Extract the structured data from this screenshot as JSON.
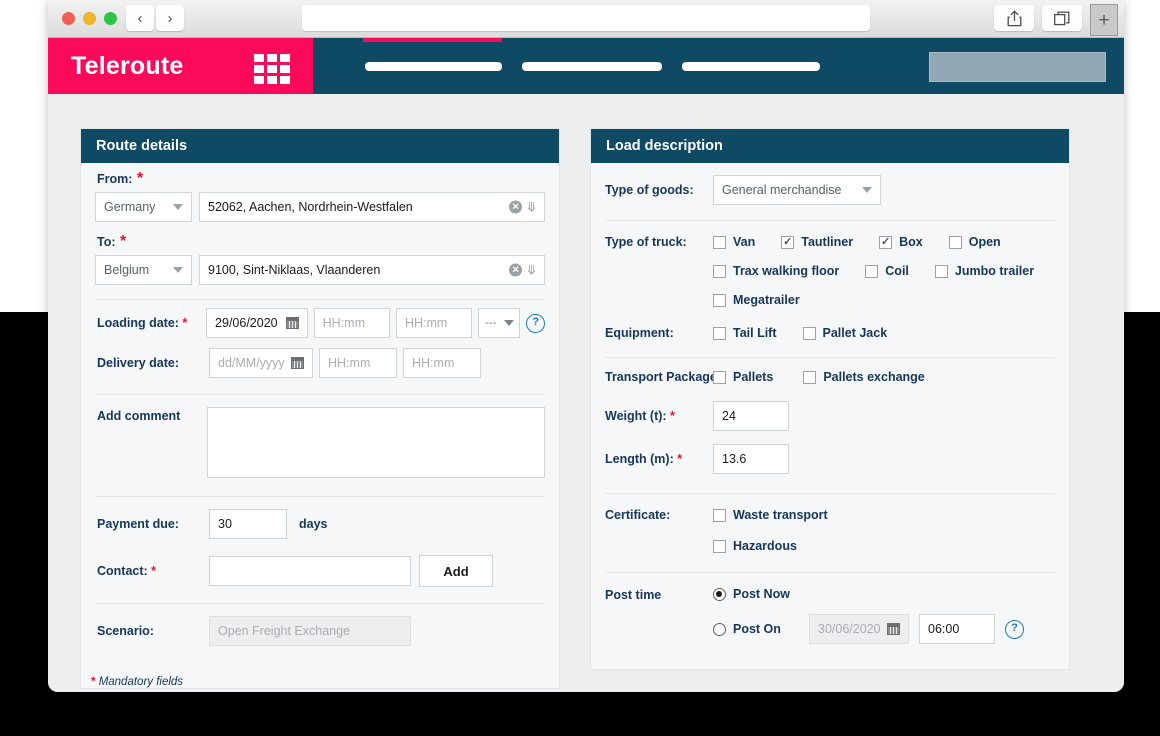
{
  "browser": {
    "back_icon": "‹",
    "forward_icon": "›",
    "url_value": "",
    "url_placeholder": "",
    "share_icon": "share-icon",
    "tabs_icon": "tabs-icon",
    "new_tab_label": "+"
  },
  "header": {
    "brand": "Teleroute",
    "apps_grid_icon": "grid-icon",
    "nav_items": [
      "",
      "",
      ""
    ],
    "account_box": ""
  },
  "route_panel": {
    "title": "Route details",
    "from_label": "From:",
    "from_country": "Germany",
    "from_location": "52062, Aachen, Nordrhein-Westfalen",
    "to_label": "To:",
    "to_country": "Belgium",
    "to_location": "9100, Sint-Niklaas, Vlaanderen",
    "loading_date_label": "Loading date:",
    "loading_date_value": "29/06/2020",
    "loading_time_from_placeholder": "HH:mm",
    "loading_time_to_placeholder": "HH:mm",
    "loading_select_value": "---",
    "delivery_date_label": "Delivery date:",
    "delivery_date_placeholder": "dd/MM/yyyy",
    "delivery_time_from_placeholder": "HH:mm",
    "delivery_time_to_placeholder": "HH:mm",
    "comment_label": "Add comment",
    "comment_value": "",
    "payment_due_label": "Payment due:",
    "payment_due_value": "30",
    "payment_due_unit": "days",
    "contact_label": "Contact:",
    "contact_value": "",
    "add_button": "Add",
    "scenario_label": "Scenario:",
    "scenario_value": "Open Freight Exchange",
    "mandatory_note": "Mandatory fields",
    "help_icon": "help-icon",
    "calendar_icon": "calendar-icon",
    "clear_icon": "clear-icon",
    "expand_icon": "double-chevron-down-icon"
  },
  "load_panel": {
    "title": "Load description",
    "goods_label": "Type of goods:",
    "goods_value": "General merchandise",
    "truck_label": "Type of truck:",
    "truck_row1": [
      {
        "label": "Van",
        "checked": false
      },
      {
        "label": "Tautliner",
        "checked": true
      },
      {
        "label": "Box",
        "checked": true
      },
      {
        "label": "Open",
        "checked": false
      }
    ],
    "truck_row2": [
      {
        "label": "Trax walking floor",
        "checked": false
      },
      {
        "label": "Coil",
        "checked": false
      },
      {
        "label": "Jumbo trailer",
        "checked": false
      }
    ],
    "truck_row3": [
      {
        "label": "Megatrailer",
        "checked": false
      }
    ],
    "equipment_label": "Equipment:",
    "equipment": [
      {
        "label": "Tail Lift",
        "checked": false
      },
      {
        "label": "Pallet Jack",
        "checked": false
      }
    ],
    "package_label": "Transport Package",
    "package": [
      {
        "label": "Pallets",
        "checked": false
      },
      {
        "label": "Pallets exchange",
        "checked": false
      }
    ],
    "weight_label": "Weight (t):",
    "weight_value": "24",
    "length_label": "Length (m):",
    "length_value": "13.6",
    "certificate_label": "Certificate:",
    "certificates": [
      {
        "label": "Waste transport",
        "checked": false
      },
      {
        "label": "Hazardous",
        "checked": false
      }
    ],
    "post_time_label": "Post time",
    "post_now_label": "Post Now",
    "post_now_selected": true,
    "post_on_label": "Post On",
    "post_on_selected": false,
    "post_on_date": "30/06/2020",
    "post_on_time": "06:00",
    "help_icon": "help-icon"
  },
  "colors": {
    "brand_pink": "#fa0a5a",
    "header_teal": "#0e4a63",
    "label_navy": "#16365a",
    "required_red": "#e8112d",
    "help_blue": "#1d7dc4",
    "page_bg": "#eceef0"
  }
}
